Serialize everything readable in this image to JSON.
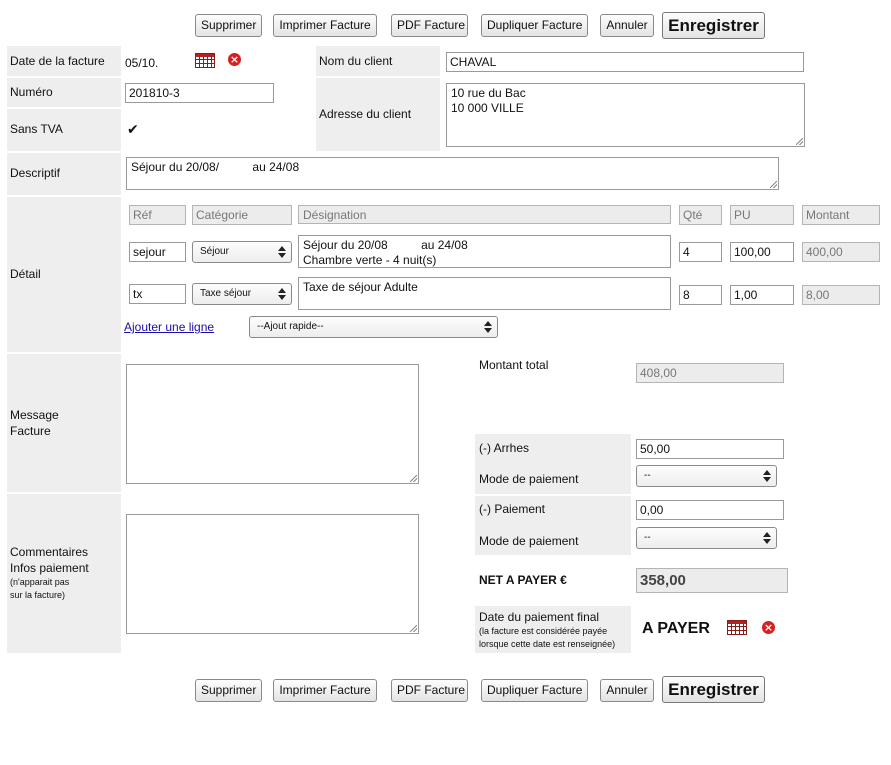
{
  "toolbar": {
    "delete": "Supprimer",
    "print": "Imprimer Facture",
    "pdf": "PDF Facture",
    "duplicate": "Dupliquer Facture",
    "cancel": "Annuler",
    "save": "Enregistrer"
  },
  "invoice": {
    "date_label": "Date de la facture",
    "date_value": "05/10.",
    "number_label": "Numéro",
    "number_value": "201810-3",
    "no_vat_label": "Sans TVA",
    "no_vat_checked": "✔",
    "client_name_label": "Nom du client",
    "client_name_value": "CHAVAL",
    "client_address_label": "Adresse du client",
    "client_address_value": "10 rue du Bac\n10 000 VILLE",
    "description_label": "Descriptif",
    "description_value": "Séjour du 20/08/          au 24/08"
  },
  "detail": {
    "label": "Détail",
    "headers": {
      "ref": "Réf",
      "category": "Catégorie",
      "designation": "Désignation",
      "qty": "Qté",
      "unit_price": "PU",
      "amount": "Montant"
    },
    "lines": [
      {
        "ref": "sejour",
        "category": "Séjour",
        "designation": "Séjour du 20/08          au 24/08\nChambre verte - 4 nuit(s)",
        "qty": "4",
        "unit_price": "100,00",
        "amount": "400,00"
      },
      {
        "ref": "tx",
        "category": "Taxe séjour",
        "designation": "Taxe de séjour Adulte",
        "qty": "8",
        "unit_price": "1,00",
        "amount": "8,00"
      }
    ],
    "add_line": "Ajouter une ligne",
    "quick_add": "--Ajout rapide--"
  },
  "message": {
    "label_1": "Message",
    "label_2": "Facture",
    "value": ""
  },
  "comments": {
    "label_1": "Commentaires",
    "label_2": "Infos paiement",
    "note_1": "(n'apparait pas",
    "note_2": "sur la facture)",
    "value": ""
  },
  "totals": {
    "total_label": "Montant total",
    "total_value": "408,00",
    "deposit_label": "(-) Arrhes",
    "deposit_value": "50,00",
    "payment_mode_label": "Mode de paiement",
    "payment_mode_value": "--",
    "payment_label": "(-) Paiement",
    "payment_value": "0,00",
    "payment_mode_label_2": "Mode de paiement",
    "payment_mode_value_2": "--",
    "net_label": "NET A PAYER €",
    "net_value": "358,00",
    "final_date_label": "Date du paiement final",
    "final_date_note_1": "(la facture est considérée payée",
    "final_date_note_2": "lorsque cette date est renseignée)",
    "final_date_status": "A PAYER"
  },
  "icons": {
    "calendar": "calendar-icon",
    "delete": "delete-icon",
    "resize": "resize-grip-icon"
  },
  "colors": {
    "label_bg": "#eeeeee",
    "delete_red": "#d42020",
    "link": "#1a0dab"
  }
}
